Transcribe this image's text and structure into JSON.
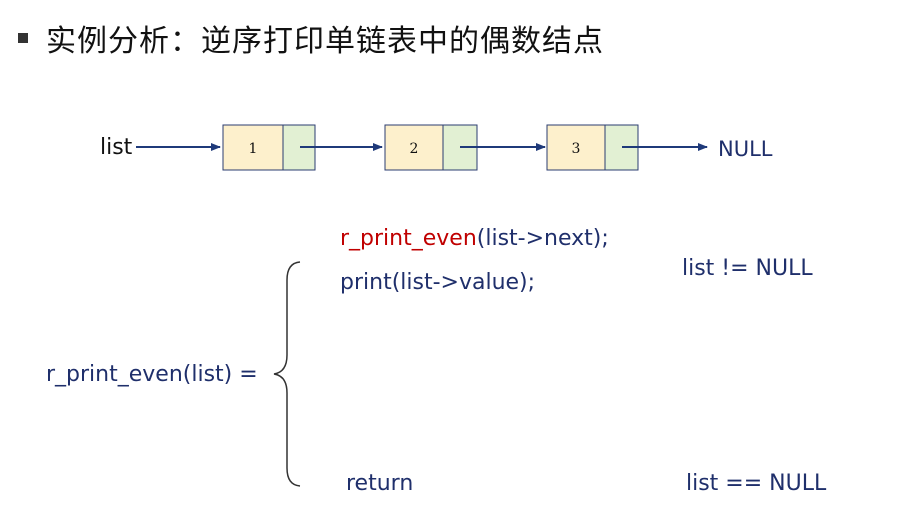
{
  "title": {
    "text": "实例分析：逆序打印单链表中的偶数结点"
  },
  "list_diagram": {
    "head_label": "list",
    "nodes": [
      {
        "value": "1"
      },
      {
        "value": "2"
      },
      {
        "value": "3"
      }
    ],
    "tail_label": "NULL"
  },
  "recursion": {
    "lhs": "r_print_even(list) =",
    "case1": {
      "line1_fn": "r_print_even",
      "line1_rest": "(list->next);",
      "line2": "print(list->value);",
      "condition": "list != NULL"
    },
    "case2": {
      "action": "return",
      "condition": "list == NULL"
    }
  },
  "colors": {
    "node_value_fill": "#fdf0cc",
    "node_next_fill": "#e2f0d3",
    "node_stroke": "#2b3d70",
    "arrow": "#1f3a7a",
    "text_navy": "#1f2f6b",
    "fn_red": "#c00000"
  }
}
